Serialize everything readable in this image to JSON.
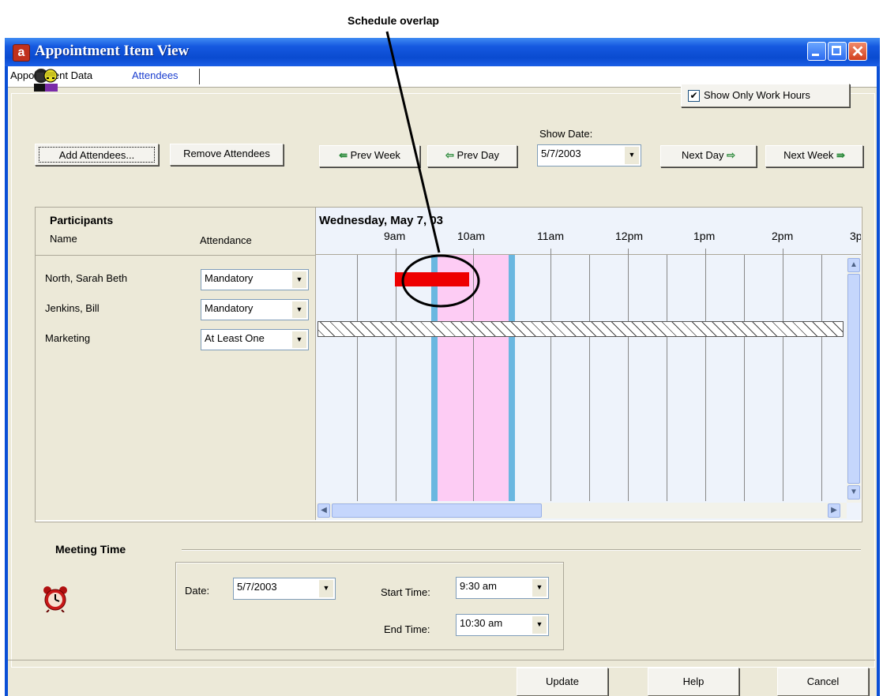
{
  "annotation": {
    "label": "Schedule overlap"
  },
  "window": {
    "title": "Appointment Item View",
    "app_icon_letter": "a"
  },
  "tabs": [
    {
      "label": "Appointment Data"
    },
    {
      "label": "Attendees"
    }
  ],
  "toolbar": {
    "add_attendees": "Add Attendees...",
    "remove_attendees": "Remove Attendees",
    "prev_week": "Prev Week",
    "prev_day": "Prev Day",
    "next_day": "Next Day",
    "next_week": "Next Week",
    "show_only_work_hours": "Show Only Work Hours",
    "show_only_work_hours_checked": true,
    "show_date_label": "Show Date:",
    "show_date_value": "5/7/2003"
  },
  "participants": {
    "title": "Participants",
    "name_header": "Name",
    "attendance_header": "Attendance",
    "rows": [
      {
        "name": "North, Sarah Beth",
        "attendance": "Mandatory"
      },
      {
        "name": "Jenkins, Bill",
        "attendance": "Mandatory"
      },
      {
        "name": "Marketing",
        "attendance": "At Least One"
      }
    ]
  },
  "schedule": {
    "date_header": "Wednesday, May 7, 03",
    "hours": [
      "9am",
      "10am",
      "11am",
      "12pm",
      "1pm",
      "2pm",
      "3p"
    ]
  },
  "meeting_time": {
    "title": "Meeting Time",
    "date_label": "Date:",
    "date_value": "5/7/2003",
    "start_label": "Start Time:",
    "start_value": "9:30 am",
    "end_label": "End Time:",
    "end_value": "10:30 am"
  },
  "buttons": {
    "update": "Update",
    "help": "Help",
    "cancel": "Cancel"
  },
  "colors": {
    "title_bar": "#0a4fd6",
    "busy": "#ee0000",
    "meeting": "#fdccf4",
    "meeting_edge": "#6ab7e0"
  }
}
